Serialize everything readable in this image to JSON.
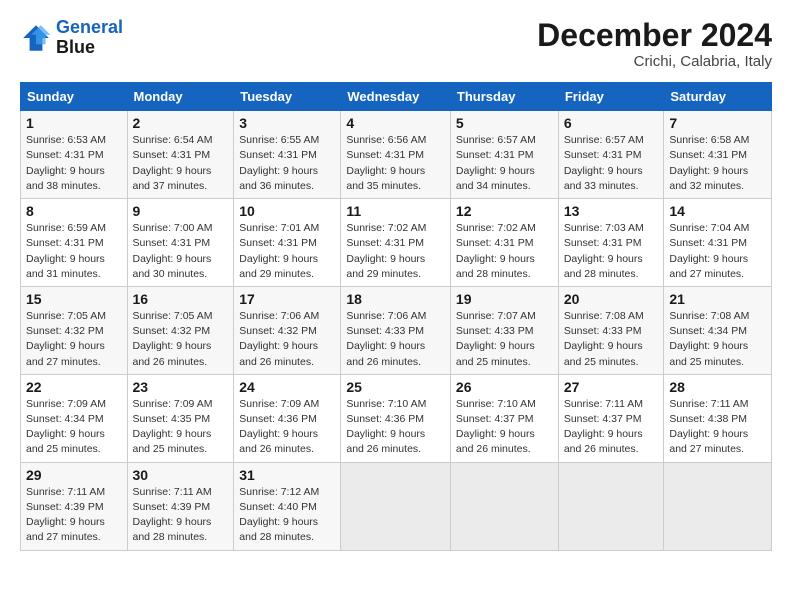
{
  "logo": {
    "line1": "General",
    "line2": "Blue"
  },
  "title": "December 2024",
  "location": "Crichi, Calabria, Italy",
  "weekdays": [
    "Sunday",
    "Monday",
    "Tuesday",
    "Wednesday",
    "Thursday",
    "Friday",
    "Saturday"
  ],
  "weeks": [
    [
      {
        "day": 1,
        "sunrise": "6:53 AM",
        "sunset": "4:31 PM",
        "daylight": "9 hours and 38 minutes."
      },
      {
        "day": 2,
        "sunrise": "6:54 AM",
        "sunset": "4:31 PM",
        "daylight": "9 hours and 37 minutes."
      },
      {
        "day": 3,
        "sunrise": "6:55 AM",
        "sunset": "4:31 PM",
        "daylight": "9 hours and 36 minutes."
      },
      {
        "day": 4,
        "sunrise": "6:56 AM",
        "sunset": "4:31 PM",
        "daylight": "9 hours and 35 minutes."
      },
      {
        "day": 5,
        "sunrise": "6:57 AM",
        "sunset": "4:31 PM",
        "daylight": "9 hours and 34 minutes."
      },
      {
        "day": 6,
        "sunrise": "6:57 AM",
        "sunset": "4:31 PM",
        "daylight": "9 hours and 33 minutes."
      },
      {
        "day": 7,
        "sunrise": "6:58 AM",
        "sunset": "4:31 PM",
        "daylight": "9 hours and 32 minutes."
      }
    ],
    [
      {
        "day": 8,
        "sunrise": "6:59 AM",
        "sunset": "4:31 PM",
        "daylight": "9 hours and 31 minutes."
      },
      {
        "day": 9,
        "sunrise": "7:00 AM",
        "sunset": "4:31 PM",
        "daylight": "9 hours and 30 minutes."
      },
      {
        "day": 10,
        "sunrise": "7:01 AM",
        "sunset": "4:31 PM",
        "daylight": "9 hours and 29 minutes."
      },
      {
        "day": 11,
        "sunrise": "7:02 AM",
        "sunset": "4:31 PM",
        "daylight": "9 hours and 29 minutes."
      },
      {
        "day": 12,
        "sunrise": "7:02 AM",
        "sunset": "4:31 PM",
        "daylight": "9 hours and 28 minutes."
      },
      {
        "day": 13,
        "sunrise": "7:03 AM",
        "sunset": "4:31 PM",
        "daylight": "9 hours and 28 minutes."
      },
      {
        "day": 14,
        "sunrise": "7:04 AM",
        "sunset": "4:31 PM",
        "daylight": "9 hours and 27 minutes."
      }
    ],
    [
      {
        "day": 15,
        "sunrise": "7:05 AM",
        "sunset": "4:32 PM",
        "daylight": "9 hours and 27 minutes."
      },
      {
        "day": 16,
        "sunrise": "7:05 AM",
        "sunset": "4:32 PM",
        "daylight": "9 hours and 26 minutes."
      },
      {
        "day": 17,
        "sunrise": "7:06 AM",
        "sunset": "4:32 PM",
        "daylight": "9 hours and 26 minutes."
      },
      {
        "day": 18,
        "sunrise": "7:06 AM",
        "sunset": "4:33 PM",
        "daylight": "9 hours and 26 minutes."
      },
      {
        "day": 19,
        "sunrise": "7:07 AM",
        "sunset": "4:33 PM",
        "daylight": "9 hours and 25 minutes."
      },
      {
        "day": 20,
        "sunrise": "7:08 AM",
        "sunset": "4:33 PM",
        "daylight": "9 hours and 25 minutes."
      },
      {
        "day": 21,
        "sunrise": "7:08 AM",
        "sunset": "4:34 PM",
        "daylight": "9 hours and 25 minutes."
      }
    ],
    [
      {
        "day": 22,
        "sunrise": "7:09 AM",
        "sunset": "4:34 PM",
        "daylight": "9 hours and 25 minutes."
      },
      {
        "day": 23,
        "sunrise": "7:09 AM",
        "sunset": "4:35 PM",
        "daylight": "9 hours and 25 minutes."
      },
      {
        "day": 24,
        "sunrise": "7:09 AM",
        "sunset": "4:36 PM",
        "daylight": "9 hours and 26 minutes."
      },
      {
        "day": 25,
        "sunrise": "7:10 AM",
        "sunset": "4:36 PM",
        "daylight": "9 hours and 26 minutes."
      },
      {
        "day": 26,
        "sunrise": "7:10 AM",
        "sunset": "4:37 PM",
        "daylight": "9 hours and 26 minutes."
      },
      {
        "day": 27,
        "sunrise": "7:11 AM",
        "sunset": "4:37 PM",
        "daylight": "9 hours and 26 minutes."
      },
      {
        "day": 28,
        "sunrise": "7:11 AM",
        "sunset": "4:38 PM",
        "daylight": "9 hours and 27 minutes."
      }
    ],
    [
      {
        "day": 29,
        "sunrise": "7:11 AM",
        "sunset": "4:39 PM",
        "daylight": "9 hours and 27 minutes."
      },
      {
        "day": 30,
        "sunrise": "7:11 AM",
        "sunset": "4:39 PM",
        "daylight": "9 hours and 28 minutes."
      },
      {
        "day": 31,
        "sunrise": "7:12 AM",
        "sunset": "4:40 PM",
        "daylight": "9 hours and 28 minutes."
      },
      null,
      null,
      null,
      null
    ]
  ]
}
